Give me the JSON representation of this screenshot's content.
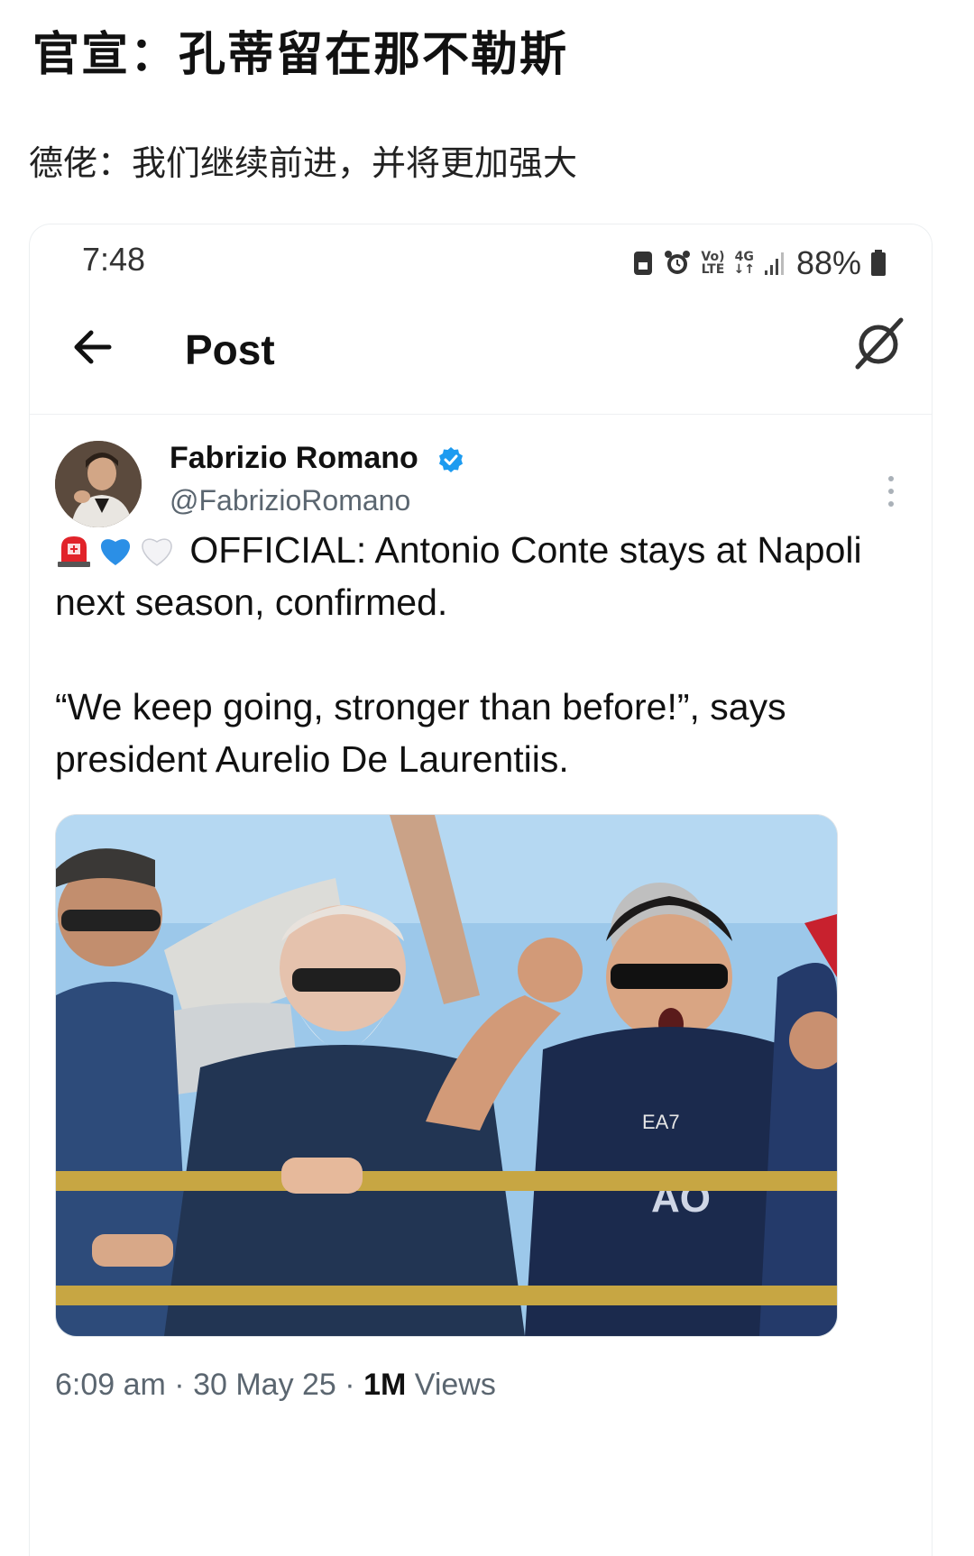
{
  "caption": {
    "headline": "官宣：孔蒂留在那不勒斯",
    "subline": "德佬：我们继续前进，并将更加强大"
  },
  "status_bar": {
    "time": "7:48",
    "network_top": "Vo)",
    "network_bottom": "LTE",
    "signal_top": "4G",
    "signal_bottom": "↓↑",
    "battery": "88%",
    "icons": [
      "save-icon",
      "alarm-icon",
      "volte-icon",
      "4g-icon",
      "signal-icon",
      "battery-icon"
    ]
  },
  "nav": {
    "title": "Post",
    "back_icon": "arrow-left-icon",
    "grok_icon": "grok-icon"
  },
  "tweet": {
    "author_name": "Fabrizio Romano",
    "handle": "@FabrizioRomano",
    "emojis": [
      "police-light-emoji",
      "blue-heart-emoji",
      "white-heart-emoji"
    ],
    "text_line1": "OFFICIAL: Antonio Conte stays at Napoli next season, confirmed.",
    "text_line2": "“We keep going, stronger than before!”, says president Aurelio De Laurentiis.",
    "time": "6:09 am",
    "date": "30 May 25",
    "views_count": "1M",
    "views_label": "Views",
    "sep": " · ",
    "photo_text_shirt": "EA7",
    "photo_text_number": "AO"
  },
  "colors": {
    "verified": "#1d9bf0",
    "muted": "#5b6670",
    "sky": "#9cc8ea"
  }
}
